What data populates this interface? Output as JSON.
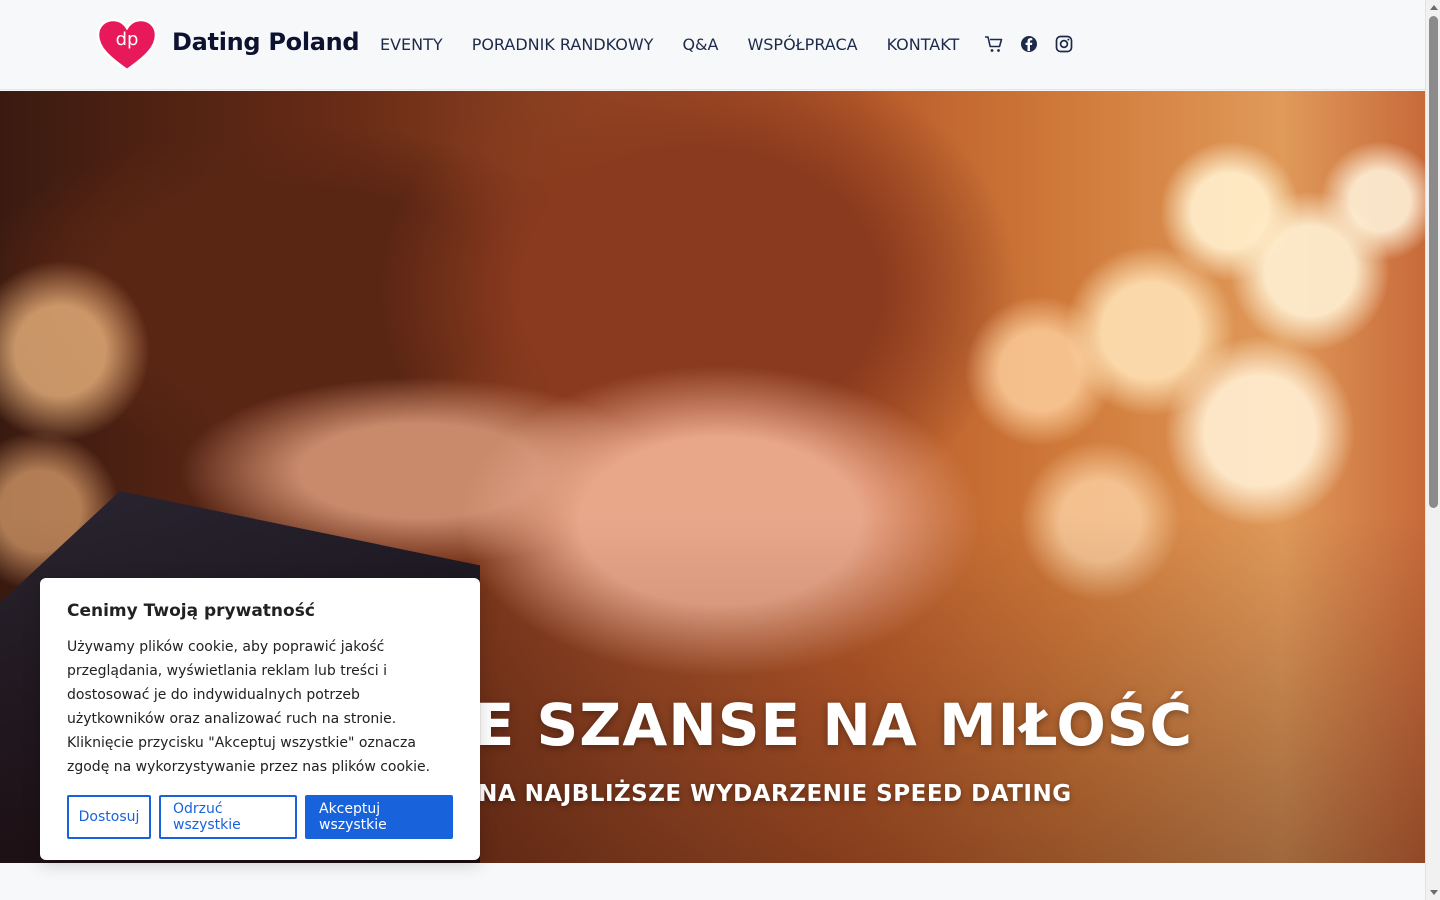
{
  "header": {
    "logo_text": "dp",
    "brand": "Dating Poland",
    "nav": [
      {
        "label": "EVENTY"
      },
      {
        "label": "PORADNIK RANDKOWY"
      },
      {
        "label": "Q&A"
      },
      {
        "label": "WSPÓŁPRACA"
      },
      {
        "label": "KONTAKT"
      }
    ],
    "icons": [
      "cart-icon",
      "facebook-icon",
      "instagram-icon"
    ]
  },
  "hero": {
    "title": "BIE SZANSE NA MIŁOŚĆ",
    "subtitle": "Ę NA NAJBLIŻSZE WYDARZENIE SPEED DATING"
  },
  "cookie": {
    "title": "Cenimy Twoją prywatność",
    "text": "Używamy plików cookie, aby poprawić jakość przeglądania, wyświetlania reklam lub treści i dostosować je do indywidualnych potrzeb użytkowników oraz analizować ruch na stronie. Kliknięcie przycisku \"Akceptuj wszystkie\" oznacza zgodę na wykorzystywanie przez nas plików cookie.",
    "btn_customize": "Dostosuj",
    "btn_reject": "Odrzuć wszystkie",
    "btn_accept": "Akceptuj wszystkie"
  },
  "colors": {
    "brand_pink": "#e8195a",
    "cookie_blue": "#1863dc",
    "nav_text": "#1e2a4a"
  }
}
